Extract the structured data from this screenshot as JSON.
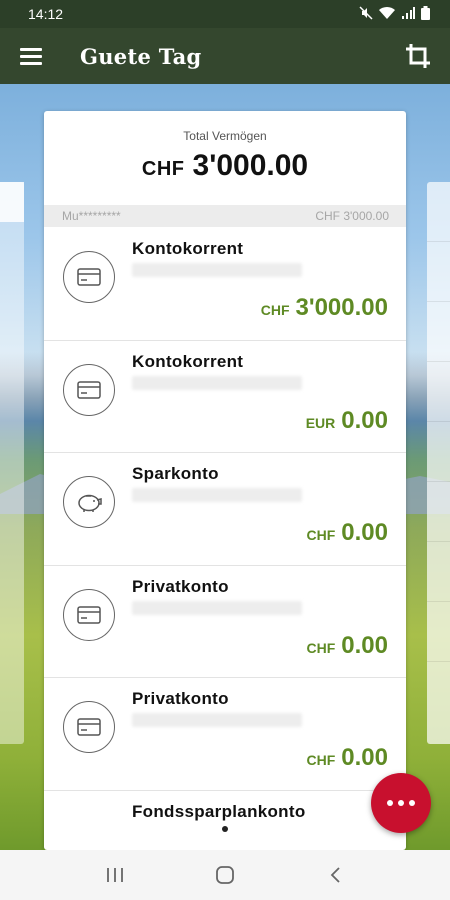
{
  "status_bar": {
    "time": "14:12"
  },
  "app_bar": {
    "title": "Guete Tag"
  },
  "summary": {
    "total_label": "Total Vermögen",
    "total_currency": "CHF",
    "total_amount": "3'000.00",
    "owner": "Mu*********",
    "owner_amount": "CHF 3'000.00"
  },
  "accounts": [
    {
      "name": "Kontokorrent",
      "currency": "CHF",
      "balance": "3'000.00",
      "icon": "card-icon"
    },
    {
      "name": "Kontokorrent",
      "currency": "EUR",
      "balance": "0.00",
      "icon": "card-icon"
    },
    {
      "name": "Sparkonto",
      "currency": "CHF",
      "balance": "0.00",
      "icon": "piggy-bank-icon"
    },
    {
      "name": "Privatkonto",
      "currency": "CHF",
      "balance": "0.00",
      "icon": "card-icon"
    },
    {
      "name": "Privatkonto",
      "currency": "CHF",
      "balance": "0.00",
      "icon": "card-icon"
    },
    {
      "name": "Fondssparplankonto"
    }
  ],
  "colors": {
    "app_bar": "#34472e",
    "balance_green": "#5e8a24",
    "fab_red": "#c8102e"
  }
}
